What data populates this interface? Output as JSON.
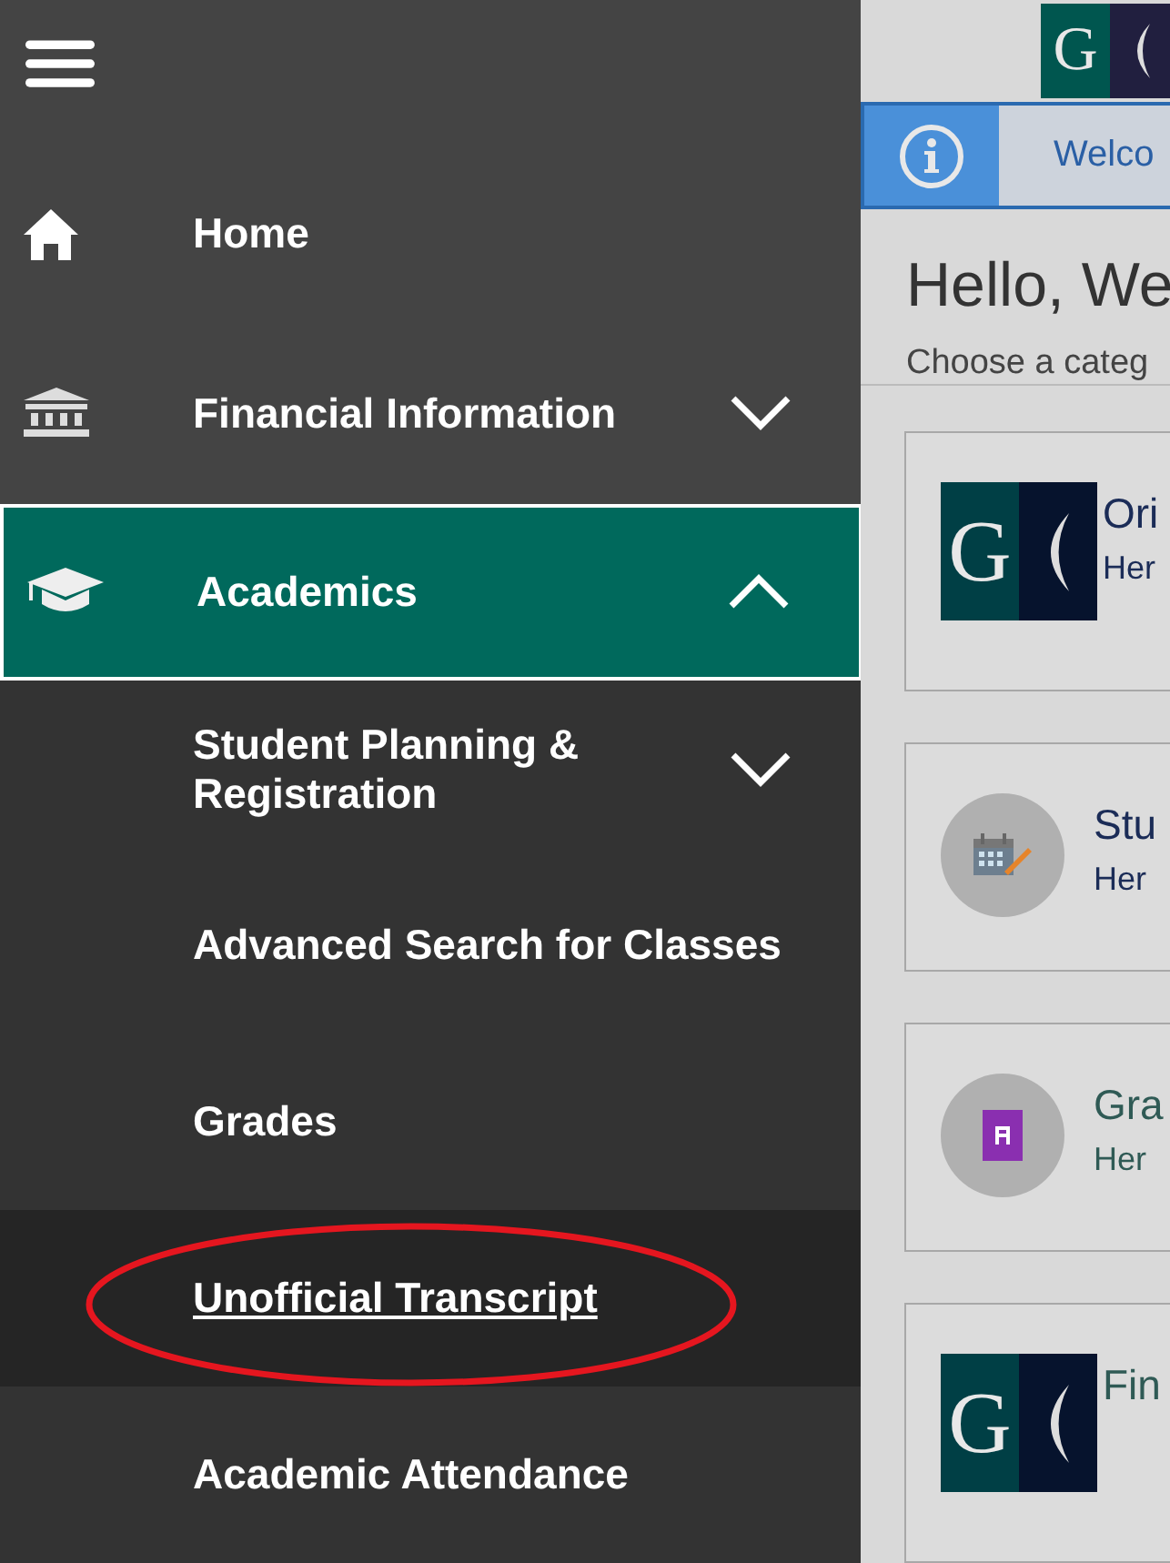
{
  "nav": {
    "items": [
      {
        "label": "Home",
        "kind": "home",
        "selected": false
      },
      {
        "label": "Financial Information",
        "kind": "bank",
        "selected": false,
        "expanded": false
      },
      {
        "label": "Academics",
        "kind": "cap",
        "selected": true,
        "expanded": true,
        "children": [
          {
            "label": "Student Planning & Registration",
            "selected": false,
            "expanded": false
          },
          {
            "label": "Advanced Search for Classes",
            "selected": false
          },
          {
            "label": "Grades",
            "selected": false
          },
          {
            "label": "Unofficial Transcript",
            "selected": true,
            "annotated": true
          },
          {
            "label": "Academic Attendance",
            "selected": false
          }
        ]
      }
    ]
  },
  "header": {
    "logo_letter": "G"
  },
  "alert": {
    "text": "Welco"
  },
  "greeting": {
    "title": "Hello, We",
    "subtitle": "Choose a categ"
  },
  "cards": [
    {
      "kind": "logo",
      "logo_letter": "G",
      "title": "Ori",
      "text": "Her",
      "color": "#1b2c57"
    },
    {
      "kind": "calendar",
      "title": "Stu",
      "text": "Her",
      "color": "#1b2c57"
    },
    {
      "kind": "grade",
      "title": "Gra",
      "text": "Her",
      "color": "#2f5a55"
    },
    {
      "kind": "logo",
      "logo_letter": "G",
      "title": "Fin",
      "color": "#2f5a55"
    }
  ]
}
